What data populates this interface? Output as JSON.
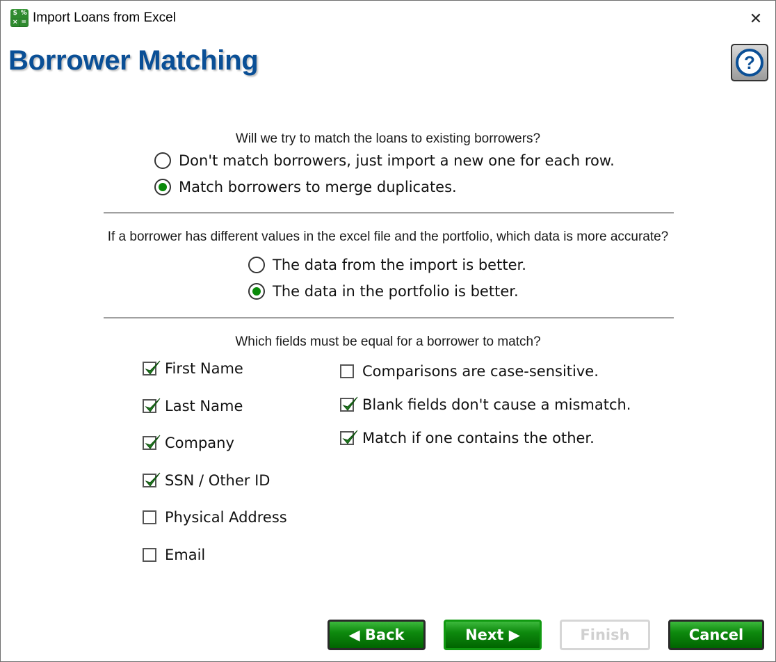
{
  "window": {
    "title": "Import Loans from Excel",
    "app_icon": "calculator-spreadsheet-icon",
    "close_icon": "close-icon",
    "close_glyph": "✕"
  },
  "header": {
    "page_title": "Borrower Matching",
    "help_glyph": "?"
  },
  "section_match": {
    "question": "Will we try to match the loans to existing borrowers?",
    "options": [
      {
        "label": "Don't match borrowers, just import a new one for each row.",
        "selected": false
      },
      {
        "label": "Match borrowers to merge duplicates.",
        "selected": true
      }
    ]
  },
  "section_accuracy": {
    "question": "If a borrower has different values in the excel file and the portfolio, which data is more accurate?",
    "options": [
      {
        "label": "The data from the import is better.",
        "selected": false
      },
      {
        "label": "The data in the portfolio is better.",
        "selected": true
      }
    ]
  },
  "section_fields": {
    "question": "Which fields must be equal for a borrower to match?",
    "fields": [
      {
        "label": "First Name",
        "checked": true
      },
      {
        "label": "Last Name",
        "checked": true
      },
      {
        "label": "Company",
        "checked": true
      },
      {
        "label": "SSN / Other ID",
        "checked": true
      },
      {
        "label": "Physical Address",
        "checked": false
      },
      {
        "label": "Email",
        "checked": false
      }
    ],
    "options": [
      {
        "label": "Comparisons are case-sensitive.",
        "checked": false
      },
      {
        "label": "Blank fields don't cause a mismatch.",
        "checked": true
      },
      {
        "label": "Match if one contains the other.",
        "checked": true
      }
    ]
  },
  "footer": {
    "back_label": "◀ Back",
    "next_label": "Next ▶",
    "finish_label": "Finish",
    "cancel_label": "Cancel",
    "finish_enabled": false
  },
  "colors": {
    "title_blue": "#0a4f96",
    "radio_green": "#0a8a0a",
    "button_green": "#006400",
    "check_green": "#1f7a1f"
  }
}
